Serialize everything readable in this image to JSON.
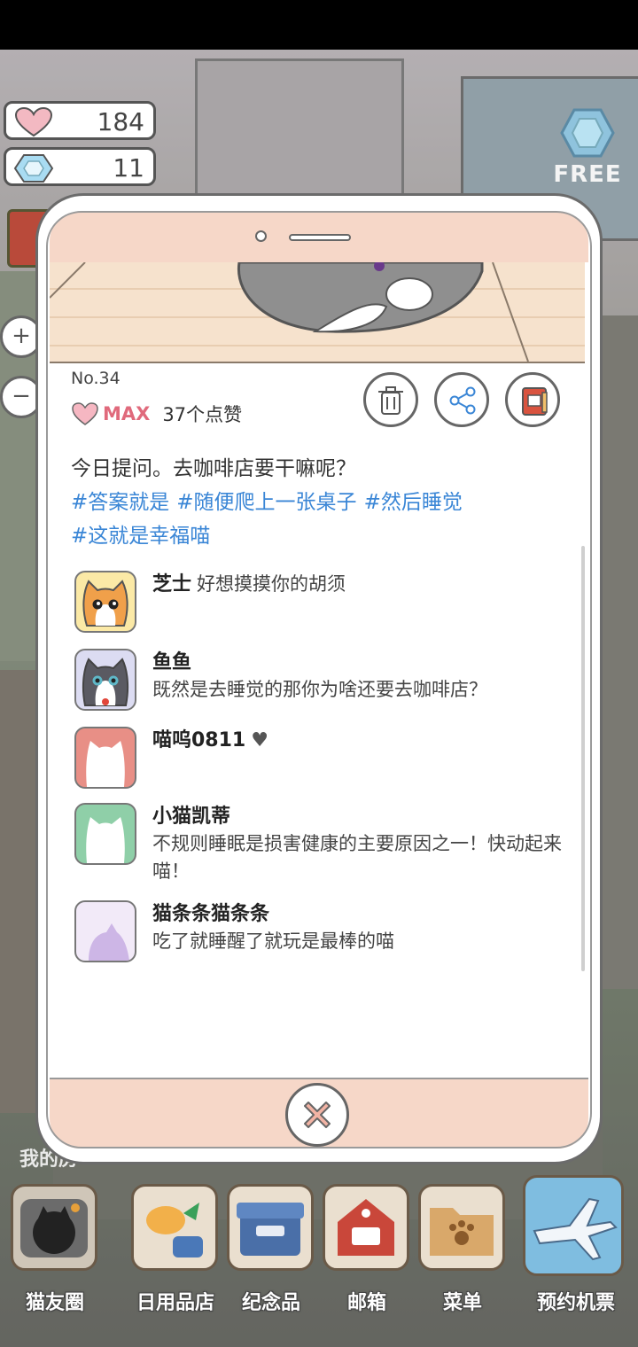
{
  "hud": {
    "hearts": "184",
    "gems": "11",
    "free_label": "FREE"
  },
  "post": {
    "number": "No.34",
    "max_label": "MAX",
    "likes": "37个点赞",
    "question": "今日提问。去咖啡店要干嘛呢？",
    "tags": [
      "#答案就是",
      "#随便爬上一张桌子",
      "#然后睡觉",
      "#这就是幸福喵"
    ]
  },
  "comments": [
    {
      "user": "芝士",
      "text": "好想摸摸你的胡须",
      "avatar": "orange-cat-avatar"
    },
    {
      "user": "鱼鱼",
      "text": "既然是去睡觉的那你为啥还要去咖啡店？",
      "avatar": "tuxedo-cat-avatar"
    },
    {
      "user": "喵呜0811",
      "text": "",
      "badge": "♥",
      "avatar": "red-cat-silhouette"
    },
    {
      "user": "小猫凯蒂",
      "text": "不规则睡眠是损害健康的主要原因之一！快动起来喵！",
      "avatar": "green-cat-silhouette"
    },
    {
      "user": "猫条条猫条条",
      "text": "吃了就睡醒了就玩是最棒的喵",
      "avatar": "purple-cat-silhouette"
    }
  ],
  "dock": {
    "items": [
      "猫友圈",
      "日用品店",
      "纪念品",
      "邮箱",
      "菜单",
      "预约机票"
    ]
  },
  "background_label": "我的房",
  "colors": {
    "phone_accent": "#f6d7c8",
    "tag_blue": "#3a86d6",
    "max_pink": "#e06a7c"
  }
}
